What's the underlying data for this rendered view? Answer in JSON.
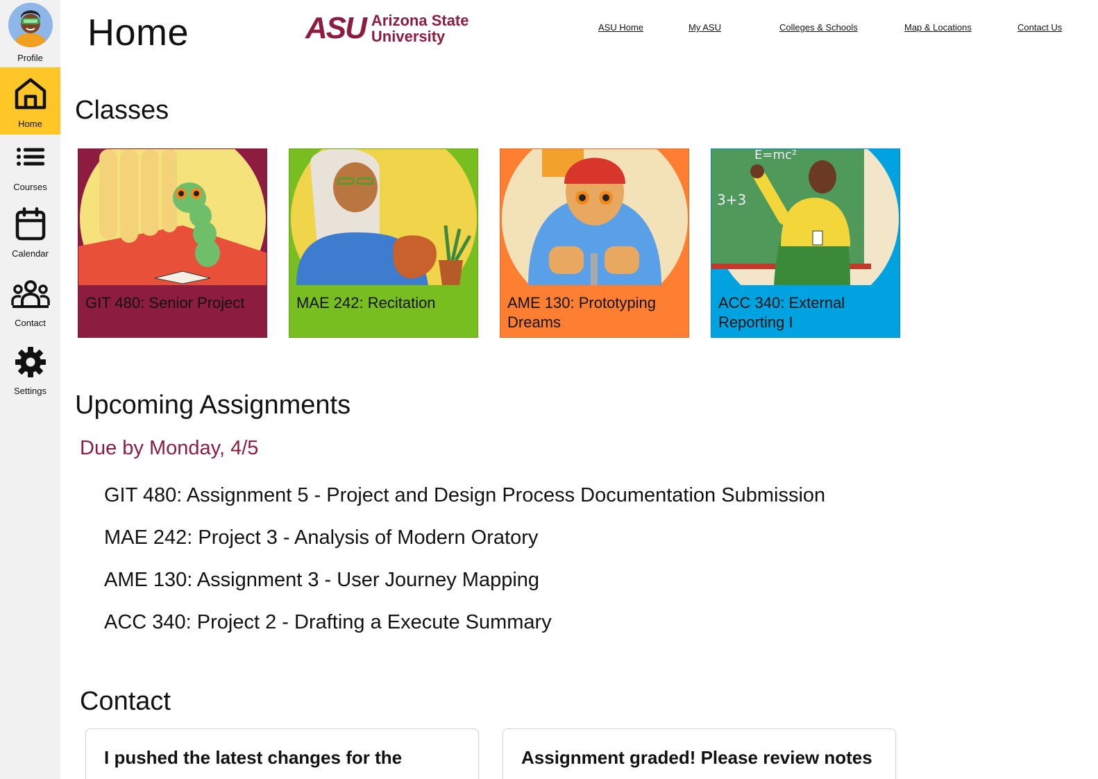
{
  "sidebar": {
    "items": [
      {
        "label": "Profile",
        "icon": "avatar"
      },
      {
        "label": "Home",
        "icon": "home-icon",
        "active": true
      },
      {
        "label": "Courses",
        "icon": "list-icon"
      },
      {
        "label": "Calendar",
        "icon": "calendar-icon"
      },
      {
        "label": "Contact",
        "icon": "people-icon"
      },
      {
        "label": "Settings",
        "icon": "gear-icon"
      }
    ]
  },
  "header": {
    "title": "Home",
    "logo": {
      "mark": "ASU",
      "line1": "Arizona State",
      "line2": "University"
    },
    "nav": [
      "ASU Home",
      "My ASU",
      "Colleges & Schools",
      "Map & Locations",
      "Contact Us"
    ]
  },
  "classes": {
    "heading": "Classes",
    "cards": [
      {
        "label": "GIT 480: Senior Project",
        "color": "#8c1d40"
      },
      {
        "label": "MAE 242: Recitation",
        "color": "#78be20"
      },
      {
        "label": "AME 130: Prototyping Dreams",
        "color": "#ff7f32"
      },
      {
        "label": "ACC 340: External Reporting I",
        "color": "#00a3e0"
      }
    ]
  },
  "assignments": {
    "heading": "Upcoming Assignments",
    "due_label": "Due by Monday, 4/5",
    "items": [
      "GIT 480: Assignment 5 - Project and Design Process Documentation Submission",
      "MAE 242: Project 3 - Analysis of Modern Oratory",
      "AME 130: Assignment 3 - User Journey Mapping",
      "ACC 340: Project 2 - Drafting a Execute Summary"
    ]
  },
  "contact": {
    "heading": "Contact",
    "messages": [
      "I pushed the latest changes for the",
      "Assignment graded! Please review notes"
    ]
  },
  "colors": {
    "maroon": "#8c1d40",
    "gold": "#ffc627",
    "sidebar_bg": "#f1f1f1"
  }
}
